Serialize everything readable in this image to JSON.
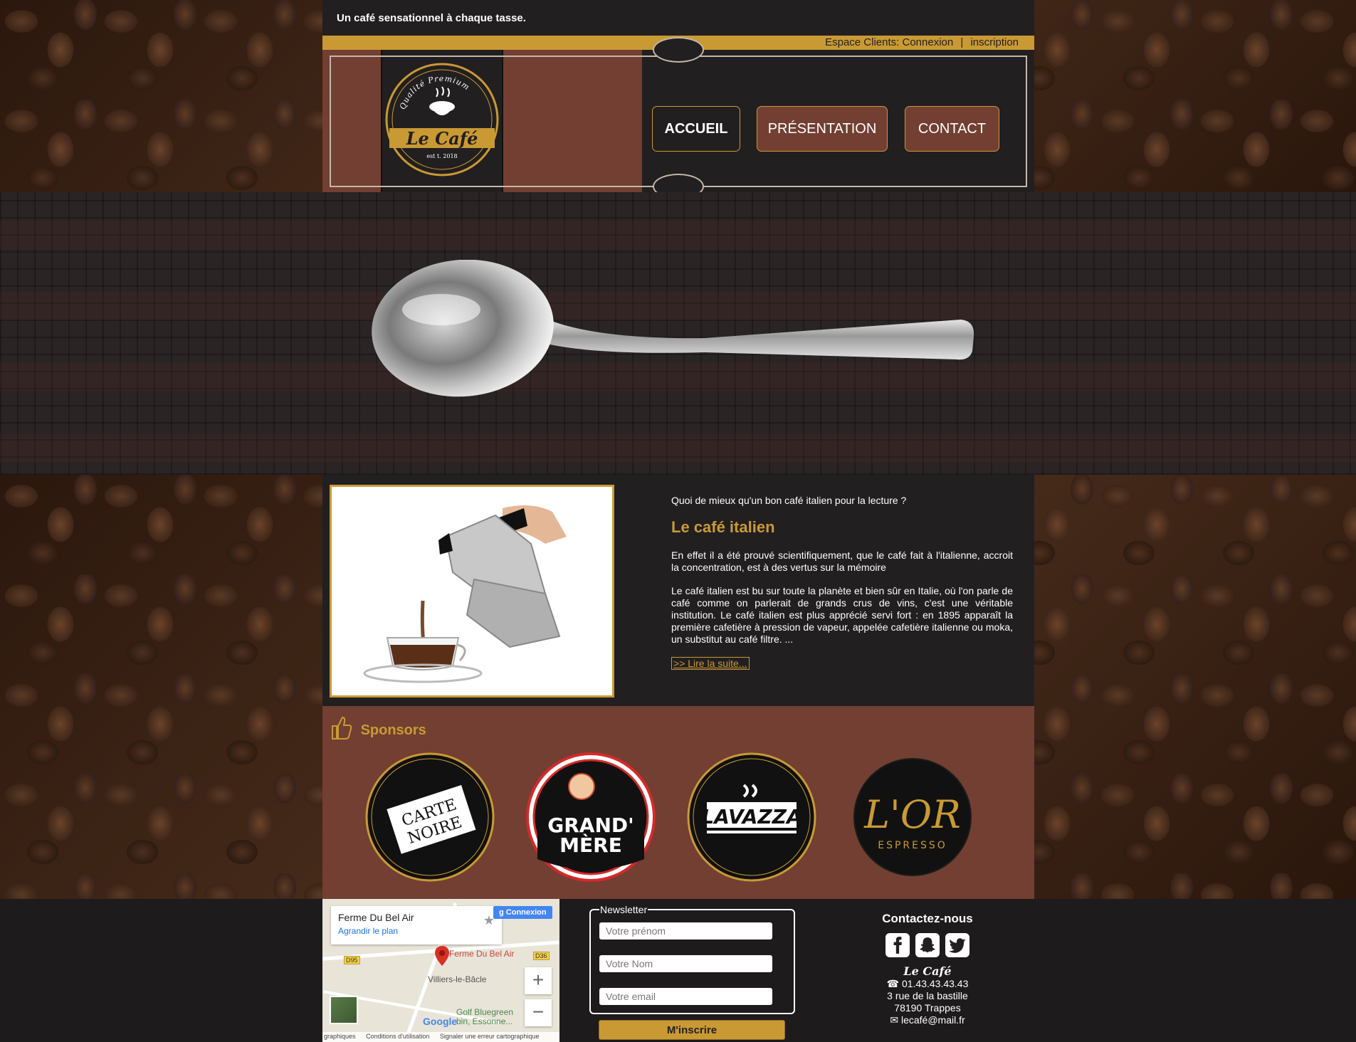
{
  "header": {
    "tagline": "Un café sensationnel à chaque tasse.",
    "account_label": "Espace Clients:",
    "login_label": "Connexion",
    "separator": "|",
    "signup_label": "inscription"
  },
  "logo": {
    "top_text": "Qualité Premium",
    "name": "Le Café",
    "established": "est t. 2018"
  },
  "nav": {
    "items": [
      {
        "label": "ACCUEIL"
      },
      {
        "label": "PRÉSENTATION"
      },
      {
        "label": "CONTACT"
      }
    ]
  },
  "article": {
    "intro": "Quoi de mieux qu'un bon café italien pour la lecture ?",
    "title": "Le café italien",
    "paragraph1": "En effet il a été prouvé scientifiquement, que le café fait à l'italienne, accroit la concentration, est à des vertus sur la mémoire",
    "paragraph2": "Le café italien est bu sur toute la planète et bien sûr en Italie, où l'on parle de café comme on parlerait de grands crus de vins, c'est une véritable institution. Le café italien est plus apprécié servi fort : en 1895 apparaît la première cafetière à pression de vapeur, appelée cafetière italienne ou moka, un substitut au café filtre. ...",
    "read_more": ">> Lire la suite..."
  },
  "sponsors": {
    "title": "Sponsors",
    "items": [
      {
        "line1": "CARTE",
        "line2": "NOIRE"
      },
      {
        "line1": "GRAND'",
        "line2": "MÈRE"
      },
      {
        "line1": "LAVAZZA",
        "line2": ""
      },
      {
        "line1": "L'OR",
        "line2": "ESPRESSO"
      }
    ]
  },
  "map": {
    "place_name": "Ferme Du Bel Air",
    "enlarge_link": "Agrandir le plan",
    "google_login": "Connexion",
    "pin_label": "Ferme Du Bel Air",
    "village": "Villiers-le-Bâcle",
    "golf_line1": "Golf Bluegreen",
    "golf_line2": "bin, Essonne...",
    "road_d95": "D95",
    "road_d36": "D36",
    "zoom_in": "+",
    "zoom_out": "−",
    "google": "Google",
    "terms": [
      "graphiques",
      "Conditions d'utilisation",
      "Signaler une erreur cartographique"
    ]
  },
  "newsletter": {
    "legend": "Newsletter",
    "firstname_placeholder": "Votre prénom",
    "lastname_placeholder": "Votre Nom",
    "email_placeholder": "Votre email",
    "submit_label": "M'inscrire"
  },
  "contact": {
    "title": "Contactez-nous",
    "brand": "Le Café",
    "phone": "☎ 01.43.43.43.43",
    "address1": "3 rue de la bastille",
    "address2": "78190 Trappes",
    "email": "✉ lecafé@mail.fr"
  },
  "colors": {
    "gold": "#c99a34",
    "brown": "#723f32",
    "dark": "#221f20"
  }
}
